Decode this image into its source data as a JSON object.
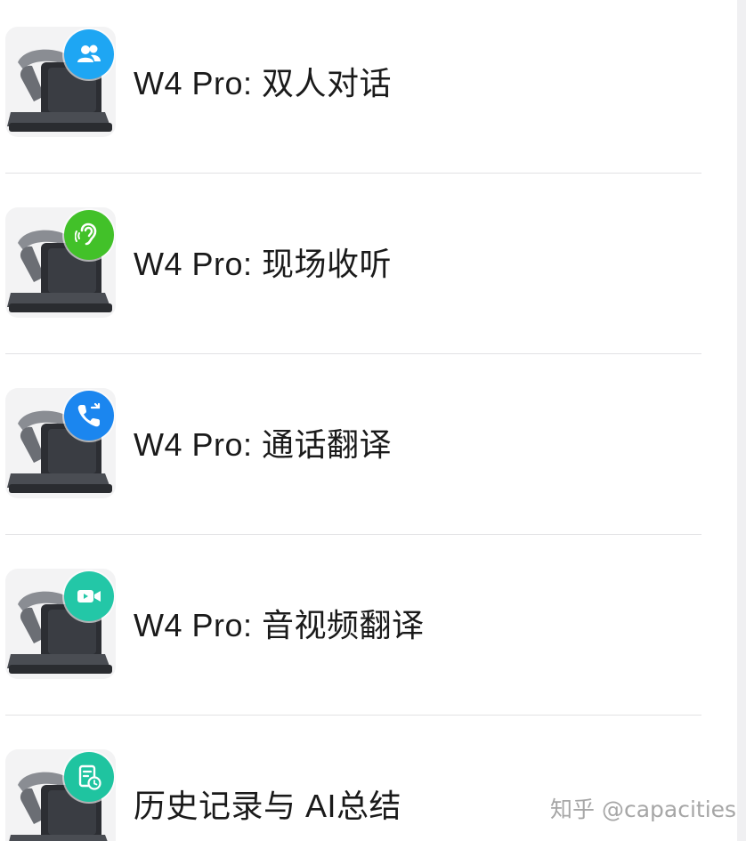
{
  "items": [
    {
      "label": "W4 Pro: 双人对话",
      "icon": "two-people-icon",
      "color": "#1ea6f3"
    },
    {
      "label": "W4 Pro: 现场收听",
      "icon": "ear-icon",
      "color": "#42c129"
    },
    {
      "label": "W4 Pro: 通话翻译",
      "icon": "phone-icon",
      "color": "#1b86ef"
    },
    {
      "label": "W4 Pro: 音视频翻译",
      "icon": "video-camera-icon",
      "color": "#23c7a7"
    },
    {
      "label": "历史记录与 AI总结",
      "icon": "history-doc-icon",
      "color": "#1fc4a0"
    }
  ],
  "watermark": "知乎 @capacities"
}
